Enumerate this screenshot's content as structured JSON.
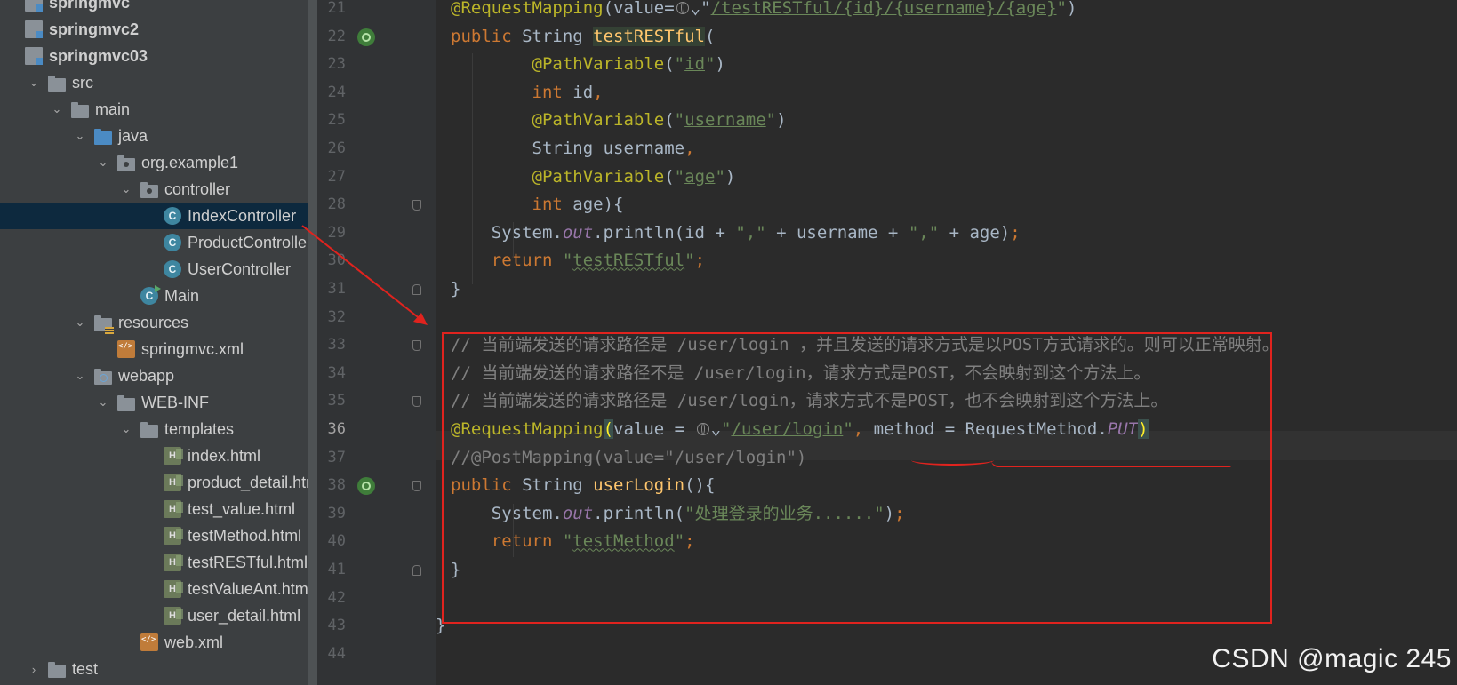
{
  "project_tree": [
    {
      "label": "springmvc",
      "level": 0,
      "expanded": false,
      "icon": "module-icon",
      "bold": true,
      "arrow": false
    },
    {
      "label": "springmvc2",
      "level": 0,
      "expanded": false,
      "icon": "module-icon",
      "bold": true,
      "arrow": false
    },
    {
      "label": "springmvc03",
      "level": 0,
      "expanded": true,
      "icon": "module-icon",
      "bold": true,
      "arrow": false
    },
    {
      "label": "src",
      "level": 1,
      "expanded": true,
      "icon": "folder-icon",
      "arrow": true
    },
    {
      "label": "main",
      "level": 2,
      "expanded": true,
      "icon": "folder-icon",
      "arrow": true
    },
    {
      "label": "java",
      "level": 3,
      "expanded": true,
      "icon": "source-folder-icon",
      "arrow": true
    },
    {
      "label": "org.example1",
      "level": 4,
      "expanded": true,
      "icon": "package-icon",
      "arrow": true
    },
    {
      "label": "controller",
      "level": 5,
      "expanded": true,
      "icon": "package-icon",
      "arrow": true
    },
    {
      "label": "IndexController",
      "level": 6,
      "icon": "class-icon",
      "selected": true
    },
    {
      "label": "ProductController",
      "level": 6,
      "icon": "class-icon"
    },
    {
      "label": "UserController",
      "level": 6,
      "icon": "class-icon"
    },
    {
      "label": "Main",
      "level": 5,
      "icon": "main-class-icon"
    },
    {
      "label": "resources",
      "level": 3,
      "expanded": true,
      "icon": "resources-folder-icon",
      "arrow": true
    },
    {
      "label": "springmvc.xml",
      "level": 4,
      "icon": "xml-file-icon"
    },
    {
      "label": "webapp",
      "level": 3,
      "expanded": true,
      "icon": "web-folder-icon",
      "arrow": true
    },
    {
      "label": "WEB-INF",
      "level": 4,
      "expanded": true,
      "icon": "folder-icon",
      "arrow": true
    },
    {
      "label": "templates",
      "level": 5,
      "expanded": true,
      "icon": "folder-icon",
      "arrow": true
    },
    {
      "label": "index.html",
      "level": 6,
      "icon": "html-file-icon"
    },
    {
      "label": "product_detail.html",
      "level": 6,
      "icon": "html-file-icon"
    },
    {
      "label": "test_value.html",
      "level": 6,
      "icon": "html-file-icon"
    },
    {
      "label": "testMethod.html",
      "level": 6,
      "icon": "html-file-icon"
    },
    {
      "label": "testRESTful.html",
      "level": 6,
      "icon": "html-file-icon"
    },
    {
      "label": "testValueAnt.html",
      "level": 6,
      "icon": "html-file-icon"
    },
    {
      "label": "user_detail.html",
      "level": 6,
      "icon": "html-file-icon"
    },
    {
      "label": "web.xml",
      "level": 5,
      "icon": "xml-file-icon"
    },
    {
      "label": "test",
      "level": 1,
      "expanded": false,
      "icon": "folder-icon",
      "arrow": true
    }
  ],
  "line_numbers": [
    "21",
    "22",
    "23",
    "24",
    "25",
    "26",
    "27",
    "28",
    "29",
    "30",
    "31",
    "32",
    "33",
    "34",
    "35",
    "36",
    "37",
    "38",
    "39",
    "40",
    "41",
    "42",
    "43",
    "44"
  ],
  "current_line": "36",
  "code_lines": [
    [
      [
        "@RequestMapping",
        "an"
      ],
      [
        "(value=",
        ""
      ],
      [
        "GLOBE",
        "globe"
      ],
      [
        "⌄",
        ""
      ],
      [
        "\"",
        ""
      ],
      [
        "/testRESTful/{id}/{username}/{age}",
        "st u"
      ],
      [
        "\"",
        "st"
      ],
      [
        ")",
        ""
      ]
    ],
    [
      [
        "public ",
        "kw"
      ],
      [
        "String ",
        ""
      ],
      [
        "testRESTful",
        "fnh"
      ],
      [
        "(",
        ""
      ]
    ],
    [
      [
        "        @PathVariable",
        "an"
      ],
      [
        "(",
        ""
      ],
      [
        "\"",
        "st"
      ],
      [
        "id",
        "st u"
      ],
      [
        "\"",
        "st"
      ],
      [
        ")",
        ""
      ]
    ],
    [
      [
        "        int ",
        "kw"
      ],
      [
        "id",
        ""
      ],
      [
        ",",
        "kw"
      ]
    ],
    [
      [
        "        @PathVariable",
        "an"
      ],
      [
        "(",
        ""
      ],
      [
        "\"",
        "st"
      ],
      [
        "username",
        "st u"
      ],
      [
        "\"",
        "st"
      ],
      [
        ")",
        ""
      ]
    ],
    [
      [
        "        String username",
        ""
      ],
      [
        ",",
        "kw"
      ]
    ],
    [
      [
        "        @PathVariable",
        "an"
      ],
      [
        "(",
        ""
      ],
      [
        "\"",
        "st"
      ],
      [
        "age",
        "st u"
      ],
      [
        "\"",
        "st"
      ],
      [
        ")",
        ""
      ]
    ],
    [
      [
        "        int ",
        "kw"
      ],
      [
        "age){",
        ""
      ]
    ],
    [
      [
        "    System.",
        ""
      ],
      [
        "out",
        "it"
      ],
      [
        ".println(id + ",
        ""
      ],
      [
        "\",\"",
        "st"
      ],
      [
        " + username + ",
        ""
      ],
      [
        "\",\"",
        "st"
      ],
      [
        " + age)",
        ""
      ],
      [
        ";",
        "kw"
      ]
    ],
    [
      [
        "    return ",
        "kw"
      ],
      [
        "\"",
        "st"
      ],
      [
        "testRESTful",
        "st sq"
      ],
      [
        "\"",
        "st"
      ],
      [
        ";",
        "kw"
      ]
    ],
    [
      [
        "}",
        ""
      ]
    ],
    [],
    [
      [
        "// 当前端发送的请求路径是 /user/login ，并且发送的请求方式是以POST方式请求的。则可以正常映射。",
        "cm"
      ]
    ],
    [
      [
        "// 当前端发送的请求路径不是 /user/login，请求方式是POST，不会映射到这个方法上。",
        "cm"
      ]
    ],
    [
      [
        "// 当前端发送的请求路径是 /user/login，请求方式不是POST，也不会映射到这个方法上。",
        "cm"
      ]
    ],
    [
      [
        "@RequestMapping",
        "an"
      ],
      [
        "(",
        "brhl"
      ],
      [
        "value = ",
        ""
      ],
      [
        "GLOBE",
        "globe"
      ],
      [
        "⌄",
        ""
      ],
      [
        "\"",
        "st"
      ],
      [
        "/user/login",
        "st u"
      ],
      [
        "\"",
        "st"
      ],
      [
        ", ",
        "kw"
      ],
      [
        "method",
        ""
      ],
      [
        " = RequestMethod.",
        ""
      ],
      [
        "PUT",
        "it"
      ],
      [
        ")",
        "brhl"
      ]
    ],
    [
      [
        "//@PostMapping(value=\"/user/login\")",
        "cm"
      ]
    ],
    [
      [
        "public ",
        "kw"
      ],
      [
        "String ",
        ""
      ],
      [
        "userLogin",
        "fn"
      ],
      [
        "(){",
        ""
      ]
    ],
    [
      [
        "    System.",
        ""
      ],
      [
        "out",
        "it"
      ],
      [
        ".println(",
        ""
      ],
      [
        "\"处理登录的业务......\"",
        "st"
      ],
      [
        ")",
        ""
      ],
      [
        ";",
        "kw"
      ]
    ],
    [
      [
        "    return ",
        "kw"
      ],
      [
        "\"",
        "st"
      ],
      [
        "testMethod",
        "st sq"
      ],
      [
        "\"",
        "st"
      ],
      [
        ";",
        "kw"
      ]
    ],
    [
      [
        "}",
        ""
      ]
    ],
    [],
    [
      [
        "}",
        ""
      ]
    ],
    []
  ],
  "code_indent": [
    "1",
    "1",
    "1",
    "1",
    "1",
    "1",
    "1",
    "1",
    "1",
    "1",
    "1",
    "0",
    "1",
    "1",
    "1",
    "1",
    "1",
    "1",
    "1",
    "1",
    "1",
    "0",
    "0",
    "0"
  ],
  "gutter_markers": {
    "bean": [
      "22",
      "38"
    ],
    "fold_down": [
      "28",
      "31",
      "33",
      "35",
      "38",
      "41"
    ],
    "bulb": "35"
  },
  "colors": {
    "annotation_red": "#e0231e",
    "keyword": "#cc7832",
    "string": "#6a8759",
    "annotation": "#bbb529",
    "comment": "#808080",
    "method": "#ffc66d"
  },
  "watermark": "CSDN @magic 245"
}
